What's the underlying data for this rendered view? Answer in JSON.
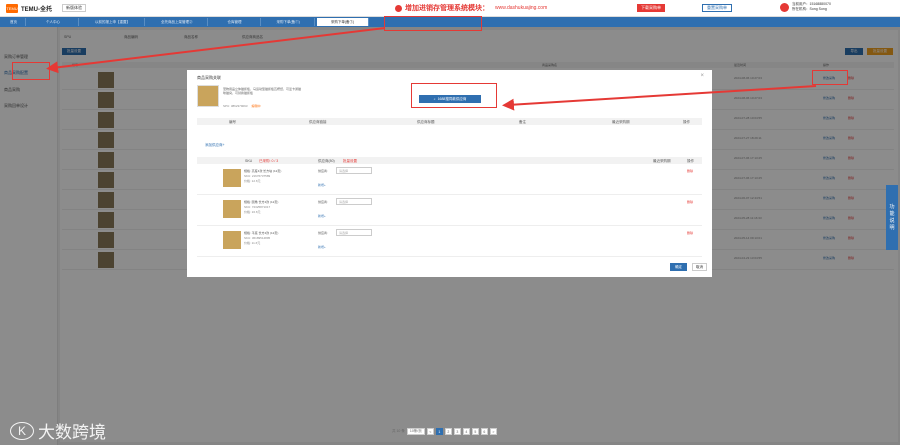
{
  "header": {
    "brand": "TEMU-全托",
    "brand_badge": "TEMU",
    "system_btn": "新版体验",
    "banner_title": "增加进销存管理系统模块：",
    "banner_url": "www.dashukuajing.com",
    "btn_order": "下载采购单",
    "btn_manage": "重置采购单",
    "user_line1": "当前用户：15168880070",
    "user_line2": "所在机构：Song Song",
    "user_badge": "切换机构"
  },
  "tabs": [
    "首页",
    "个人中心",
    "以前的报上申【重置】",
    "全托商品上架管理②",
    "仓库管理",
    "采购下单(备①)",
    "采购下单(备⑦)"
  ],
  "sidebar": [
    "采购订单管理",
    "商品采购配置",
    "商品采购",
    "采购回单设计"
  ],
  "filters": {
    "f1": "SPU",
    "f2": "商品编码",
    "f3": "商品名称",
    "f4": "供应商商品名"
  },
  "toolbar": {
    "batch": "批量设置",
    "r1": "导出",
    "r2": "批量设置"
  },
  "bg_head": [
    "编号",
    "商品采购名",
    "最近时间",
    "操作"
  ],
  "bg_rows": [
    {
      "date": "2024-08-06 10:27:03",
      "link": "修改采购",
      "del": "删除"
    },
    {
      "date": "2024-08-06 10:27:03",
      "link": "修改采购",
      "del": "删除"
    },
    {
      "date": "2024-07-28 10:04:55",
      "link": "修改采购",
      "del": "删除"
    },
    {
      "date": "2024-07-27 18:29:11",
      "link": "修改采购",
      "del": "删除"
    },
    {
      "date": "2024-07-06 17:13:25",
      "link": "修改采购",
      "del": "删除"
    },
    {
      "date": "2024-07-06 17:13:25",
      "link": "修改采购",
      "del": "删除"
    },
    {
      "date": "2024-06-07 12:44:51",
      "link": "修改采购",
      "del": "删除"
    },
    {
      "date": "2024-05-28 11:16:33",
      "link": "修改采购",
      "del": "删除"
    },
    {
      "date": "2024-05-14 09:13:01",
      "link": "修改采购",
      "del": "删除"
    },
    {
      "date": "2024-04-23 13:04:55",
      "link": "修改采购",
      "del": "删除"
    }
  ],
  "modal": {
    "title": "商品采购关联",
    "product_text": "宠物用品立体猫抓板，马运动型猫抓板瓦楞纸，可爱卡通猫咪猫窝，可替换猫抓板",
    "spu": "SPU: 3862379093",
    "spu_tag": "编辑中",
    "btn_1688": "1688搜同款供应商",
    "head1": [
      "编号",
      "供应商链接",
      "供应商标题",
      "备注",
      "最近采购期",
      "操作"
    ],
    "add_supplier": "添加供应商+",
    "head2": [
      "SKU",
      "已采购: 0 / 3",
      "供应商(80)",
      "批量设置",
      "最近采购期",
      "操作"
    ],
    "sku_rows": [
      {
        "name": "规格: 高度4款 长方块 (12页)",
        "code": "SKU: 21676737589",
        "price": "价格: 12.6元",
        "sup_label": "供应商:",
        "sup_ph": "请选择",
        "add": "新增+",
        "del": "删除"
      },
      {
        "name": "规格: 圆角 长方4款 (12页)",
        "code": "SKU: 72325871017",
        "price": "价格: 16.6元",
        "sup_label": "供应商:",
        "sup_ph": "请选择",
        "add": "新增+",
        "del": "删除"
      },
      {
        "name": "规格: 平底 长方4款 (12页)",
        "code": "SKU: 36189514895",
        "price": "价格: 11.6元",
        "sup_label": "供应商:",
        "sup_ph": "请选择",
        "add": "新增+",
        "del": "删除"
      }
    ],
    "ok": "确定",
    "cancel": "取消",
    "close": "×"
  },
  "pager": {
    "total": "共 10 条",
    "size": "10条/页",
    "pages": [
      "1",
      "2",
      "3",
      "4",
      "5",
      "6"
    ],
    "next": ">",
    "prev": "<"
  },
  "help": [
    "功",
    "能",
    "说",
    "明"
  ],
  "watermark": "大数跨境",
  "watermark_logo": "K"
}
